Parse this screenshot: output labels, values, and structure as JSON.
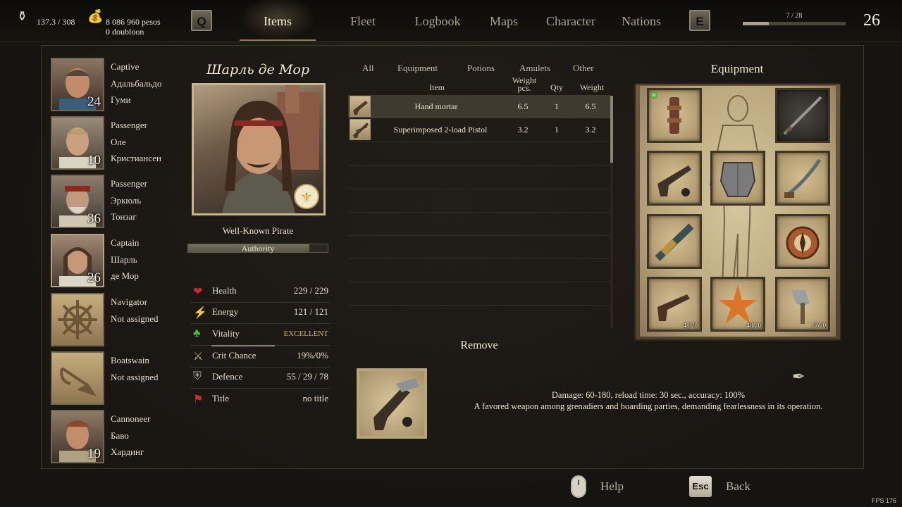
{
  "topbar": {
    "weight": "137.3 / 308",
    "money_pesos": "8 086 960 pesos",
    "money_doubloon": "0 doubloon",
    "key_left": "Q",
    "key_right": "E",
    "tabs": [
      "Items",
      "Fleet",
      "Logbook",
      "Maps",
      "Character",
      "Nations"
    ],
    "active_tab": "Items",
    "xp_text": "7 / 28",
    "xp_progress": 0.25,
    "rank": "26"
  },
  "crew": [
    {
      "role": "Captive",
      "name1": "Адальбальдо",
      "name2": "Гуми",
      "level": "24"
    },
    {
      "role": "Passenger",
      "name1": "Оле",
      "name2": "Кристиансен",
      "level": "10"
    },
    {
      "role": "Passenger",
      "name1": "Эркюль",
      "name2": "Тонзаг",
      "level": "36"
    },
    {
      "role": "Captain",
      "name1": "Шарль",
      "name2": "де Мор",
      "level": "26"
    },
    {
      "role": "Navigator",
      "name1": "Not assigned",
      "name2": "",
      "level": ""
    },
    {
      "role": "Boatswain",
      "name1": "Not assigned",
      "name2": "",
      "level": ""
    },
    {
      "role": "Cannoneer",
      "name1": "Баво",
      "name2": "Хардинг",
      "level": "19"
    }
  ],
  "character": {
    "name": "Шарль де Мор",
    "title": "Well-Known Pirate",
    "authority_label": "Authority",
    "authority_progress": 0.87,
    "stats": [
      {
        "icon": "heart-icon",
        "name": "Health",
        "value": "229 / 229"
      },
      {
        "icon": "energy-icon",
        "name": "Energy",
        "value": "121 / 121"
      },
      {
        "icon": "clover-icon",
        "name": "Vitality",
        "value": "EXCELLENT"
      },
      {
        "icon": "crit-icon",
        "name": "Crit Chance",
        "value": "19%/0%"
      },
      {
        "icon": "armor-icon",
        "name": "Defence",
        "value": "55 / 29 / 78"
      },
      {
        "icon": "flag-icon",
        "name": "Title",
        "value": "no title"
      }
    ]
  },
  "items": {
    "filters": [
      "All",
      "Equipment",
      "Potions",
      "Amulets",
      "Other"
    ],
    "headers": {
      "item": "Item",
      "weight_pcs_1": "Weight",
      "weight_pcs_2": "pcs.",
      "qty": "Qty",
      "weight": "Weight"
    },
    "rows": [
      {
        "name": "Hand mortar",
        "weight_pcs": "6.5",
        "qty": "1",
        "weight": "6.5",
        "selected": true
      },
      {
        "name": "Superimposed 2-load Pistol",
        "weight_pcs": "3.2",
        "qty": "1",
        "weight": "3.2",
        "selected": false
      }
    ]
  },
  "equipment": {
    "title": "Equipment",
    "slots": [
      {
        "name": "amulet-slot",
        "count": ""
      },
      {
        "name": "musket-slot",
        "count": ""
      },
      {
        "name": "pistol-slot",
        "count": ""
      },
      {
        "name": "cuirass-slot",
        "count": ""
      },
      {
        "name": "saber-slot",
        "count": ""
      },
      {
        "name": "spyglass-slot",
        "count": ""
      },
      {
        "name": "compass-slot",
        "count": ""
      },
      {
        "name": "ammo-slot",
        "count": "48/70"
      },
      {
        "name": "gunpowder-slot",
        "count": "48/70"
      },
      {
        "name": "grapeshot-slot",
        "count": "17/70"
      }
    ]
  },
  "action": {
    "remove_label": "Remove"
  },
  "description": {
    "line1": "Damage: 60-180, reload time: 30 sec., accuracy: 100%",
    "line2": "A favored weapon among grenadiers and boarding parties, demanding fearlessness in its operation."
  },
  "footer": {
    "help": "Help",
    "esc_key": "Esc",
    "back": "Back",
    "fps": "FPS 176"
  },
  "colors": {
    "accent": "#c8b58c",
    "background": "#1a1713",
    "text": "#e6dcc6"
  }
}
